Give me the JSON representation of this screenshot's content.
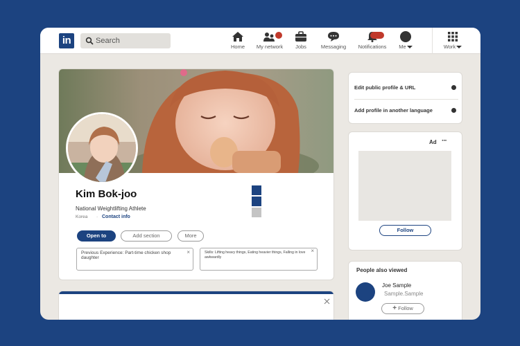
{
  "search": {
    "placeholder": "Search"
  },
  "nav": {
    "items": [
      {
        "label": "Home",
        "icon": "home-icon"
      },
      {
        "label": "My network",
        "icon": "people-icon"
      },
      {
        "label": "Jobs",
        "icon": "briefcase-icon"
      },
      {
        "label": "Messaging",
        "icon": "chat-icon"
      },
      {
        "label": "Notifications",
        "icon": "bell-icon"
      },
      {
        "label": "Me",
        "icon": "me-avatar-icon"
      },
      {
        "label": "Work",
        "icon": "grid-icon"
      }
    ]
  },
  "logo": {
    "text": "in"
  },
  "profile": {
    "name": "Kim Bok-joo",
    "headline": "National Weightlifting Athlete",
    "location": "Korea",
    "separator": "·",
    "contact_label": "Contact info",
    "buttons": {
      "open_to": "Open to",
      "add_section": "Add section",
      "more": "More"
    },
    "info_boxes": [
      {
        "text": "Previous Experience: Part-time chicken shop daughter"
      },
      {
        "text": "Skills: Lifting heavy things, Eating heavier things, Falling in love awkwardly"
      }
    ]
  },
  "right_panel": {
    "links": [
      "Edit public profile & URL",
      "Add profile in another language"
    ],
    "ad": {
      "label": "Ad",
      "more": "···",
      "follow_label": "Follow"
    },
    "people": {
      "title": "People also viewed",
      "person": {
        "name": "Joe Sample",
        "subtitle": "Sample.Sample",
        "follow_label": "Follow"
      }
    }
  },
  "colors": {
    "brand": "#1c4380",
    "background": "#ebe8e3",
    "badge": "#c0392b"
  }
}
